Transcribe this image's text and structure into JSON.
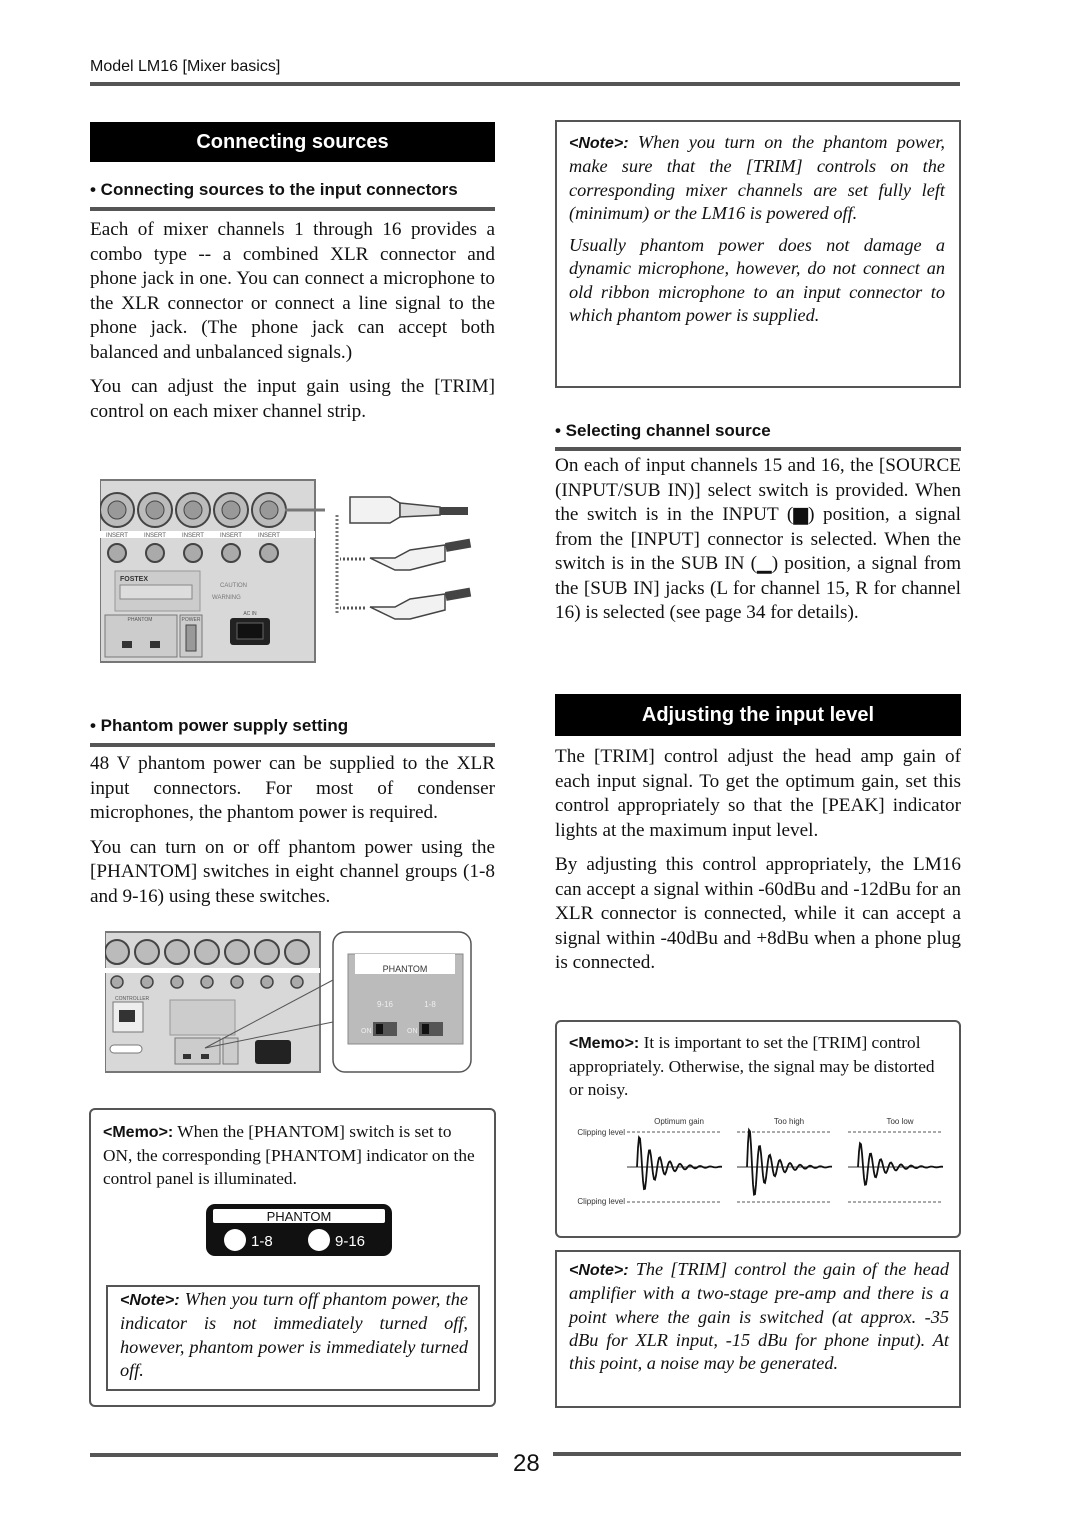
{
  "header": {
    "running_head": "Model LM16 [Mixer basics]"
  },
  "left": {
    "section_title": "Connecting sources",
    "sub1": {
      "title": "• Connecting sources to the input connectors",
      "paragraphs": [
        "Each of mixer channels 1 through 16 provides a combo type -- a combined XLR connector and phone jack in one. You can connect a microphone to the XLR connector or connect a line signal to the phone jack. (The phone jack can accept both balanced and unbalanced signals.)",
        "You can adjust the input gain using the [TRIM] control on each mixer channel strip."
      ]
    },
    "figure1": {
      "insert_label": "INSERT",
      "brand": "FOSTEX",
      "phantom_label": "PHANTOM",
      "power_label": "POWER",
      "ac_label": "AC IN",
      "caution_label": "CAUTION",
      "warning_label": "WARNING"
    },
    "sub2": {
      "title": "• Phantom power supply setting",
      "paragraphs": [
        "48 V phantom power can be supplied to the XLR input connectors. For most of condenser microphones, the phantom power is required.",
        "You can turn on or off phantom power using the [PHANTOM] switches in eight channel groups (1-8 and 9-16) using these switches."
      ]
    },
    "figure2": {
      "callout_title": "PHANTOM",
      "group_a": "9-16",
      "group_b": "1-8",
      "on_label": "ON",
      "controller_label": "CONTROLLER"
    },
    "memo": {
      "label": "<Memo>:",
      "text": " When the [PHANTOM] switch is set to ON, the corresponding [PHANTOM] indicator on the control panel is illuminated."
    },
    "indicator": {
      "title": "PHANTOM",
      "group_1": "1-8",
      "group_2": "9-16"
    },
    "note": {
      "label": "<Note>:",
      "text": " When you turn off phantom power, the indicator is not immediately turned off, however, phantom power is immediately turned off."
    }
  },
  "right": {
    "note_top": {
      "label": "<Note>:",
      "text1": " When you turn on the phantom power, make sure that the [TRIM] controls on the corresponding mixer channels are set fully left (minimum) or the LM16 is powered off.",
      "text2": "Usually phantom power does not damage a dynamic microphone, however, do not connect an old ribbon microphone to an input connector to which phantom power is supplied."
    },
    "sub3": {
      "title": "• Selecting channel source",
      "paragraph": "On each of input channels 15 and 16, the [SOURCE (INPUT/SUB IN)] select switch is provided. When the switch is in the INPUT (▆) position, a signal from the [INPUT] connector is selected. When the switch is in the SUB IN (▁) position, a signal from the [SUB IN] jacks (L for channel 15, R for channel 16) is selected (see page 34 for details)."
    },
    "section2_title": "Adjusting the input level",
    "section2_paragraphs": [
      "The [TRIM] control adjust the head amp gain of each input signal. To get the optimum gain, set this control appropriately so that the [PEAK] indicator lights at the maximum input level.",
      "By adjusting this control appropriately, the LM16 can accept a signal within -60dBu and -12dBu for an XLR connector is connected, while it can accept a signal within -40dBu and +8dBu when a phone plug is connected."
    ],
    "memo": {
      "label": "<Memo>:",
      "text": " It is important to set the [TRIM] control appropriately. Otherwise, the signal may be distorted or noisy."
    },
    "waveforms": {
      "clip_label_top": "Clipping level",
      "clip_label_bottom": "Clipping level",
      "panels": [
        {
          "label": "Optimum gain",
          "amplitude": 1.0
        },
        {
          "label": "Too high",
          "amplitude": 1.25
        },
        {
          "label": "Too low",
          "amplitude": 0.8
        }
      ]
    },
    "note_bottom": {
      "label": "<Note>:",
      "text": " The [TRIM] control the gain of the head amplifier with a two-stage pre-amp and there is a point where the gain is switched (at approx. -35 dBu for XLR input, -15 dBu for phone input). At this point, a noise may be generated."
    }
  },
  "footer": {
    "page_number": "28"
  }
}
